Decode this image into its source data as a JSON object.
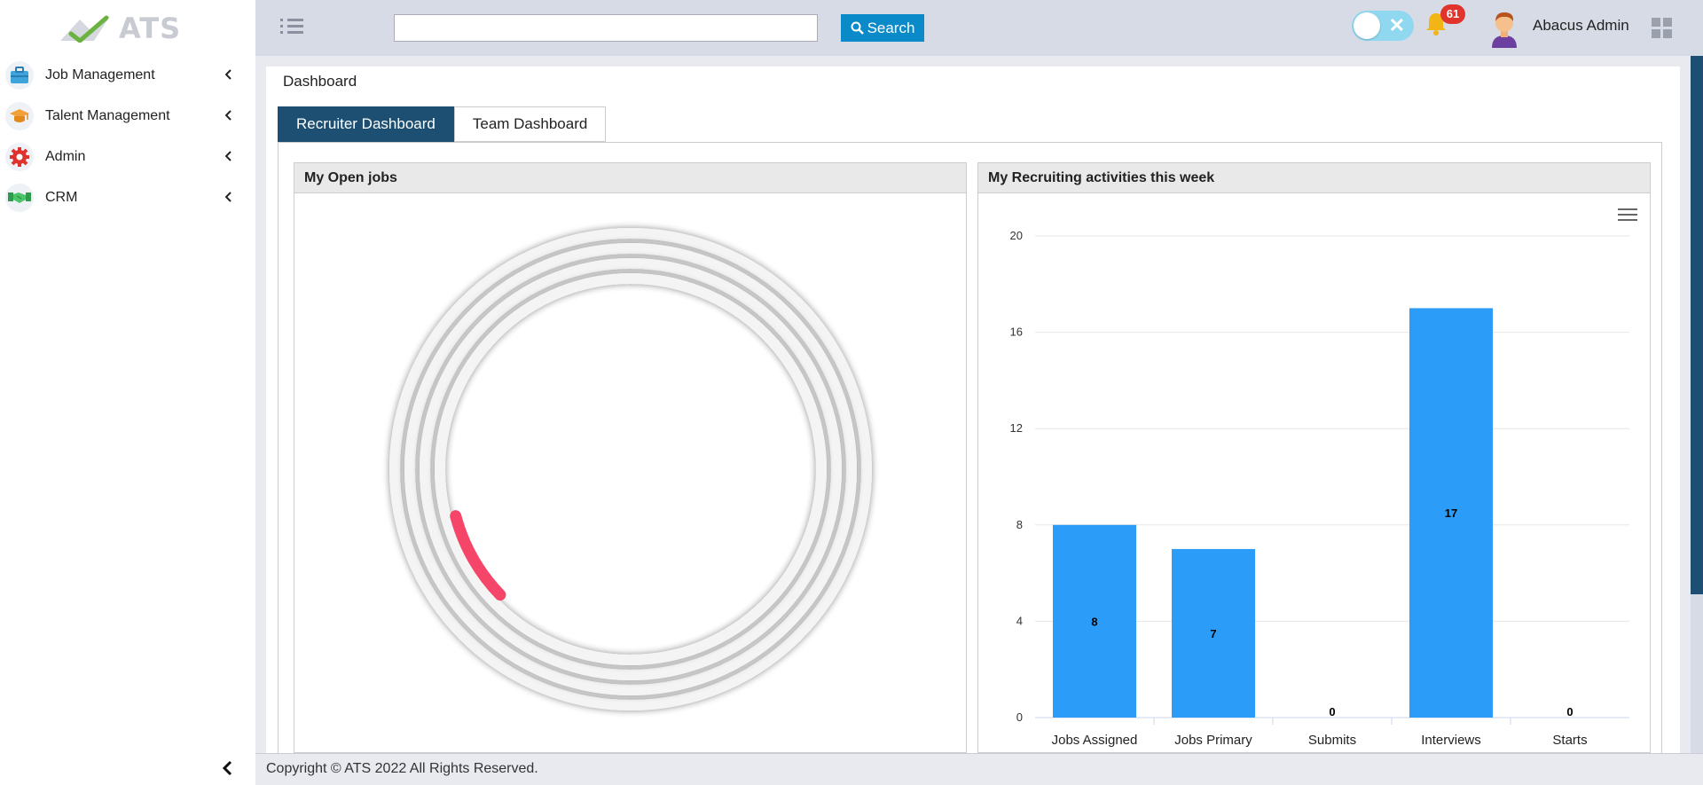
{
  "app": {
    "logo_text": "ATS"
  },
  "sidebar": {
    "items": [
      {
        "label": "Job Management",
        "icon": "briefcase-icon"
      },
      {
        "label": "Talent Management",
        "icon": "graduation-cap-icon"
      },
      {
        "label": "Admin",
        "icon": "gear-icon"
      },
      {
        "label": "CRM",
        "icon": "handshake-icon"
      }
    ]
  },
  "topbar": {
    "search_placeholder": "",
    "search_label": "Search",
    "notification_count": "61",
    "user_name": "Abacus Admin"
  },
  "breadcrumb": "Dashboard",
  "tabs": [
    {
      "label": "Recruiter Dashboard",
      "active": true
    },
    {
      "label": "Team Dashboard",
      "active": false
    }
  ],
  "panels": {
    "open_jobs": {
      "title": "My Open jobs"
    },
    "activities": {
      "title": "My Recruiting activities this week"
    }
  },
  "chart_data": {
    "type": "bar",
    "categories": [
      "Jobs Assigned",
      "Jobs Primary",
      "Submits",
      "Interviews",
      "Starts"
    ],
    "values": [
      8,
      7,
      0,
      17,
      0
    ],
    "data_labels": [
      "8",
      "7",
      "0",
      "17",
      "0"
    ],
    "yticks": [
      "0",
      "4",
      "8",
      "12",
      "16",
      "20"
    ],
    "ylim": [
      0,
      20
    ],
    "grid": true,
    "bar_color": "#2b9cf7"
  },
  "footer": {
    "copyright": "Copyright ©  ATS  2022 All Rights Reserved."
  },
  "colors": {
    "accent": "#1d4f72",
    "search_button": "#0b8ac9",
    "badge": "#e0342c",
    "gauge_arc": "#f5466a"
  }
}
